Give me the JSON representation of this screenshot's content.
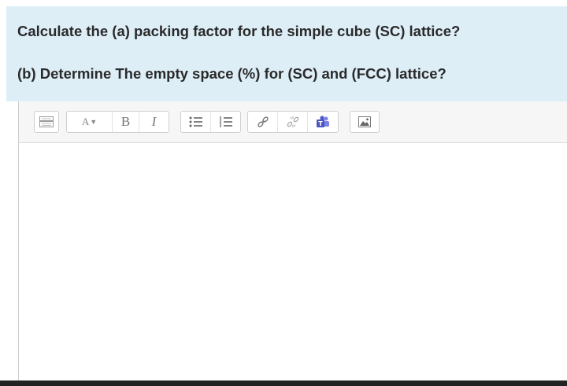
{
  "question": {
    "line1": "Calculate the (a) packing factor for the simple cube (SC) lattice?",
    "line2": "(b) Determine The empty space (%) for (SC) and (FCC) lattice?"
  },
  "toolbar": {
    "bold_label": "B",
    "italic_label": "I",
    "font_style_label": "A"
  },
  "editor": {
    "content": ""
  },
  "colors": {
    "question_bg": "#deeef7",
    "toolbar_bg": "#f6f6f6",
    "teams_icon": "#4b53bc"
  }
}
